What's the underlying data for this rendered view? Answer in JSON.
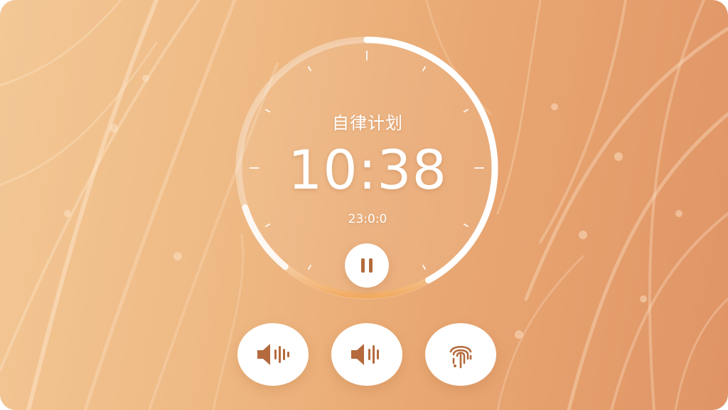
{
  "timer": {
    "label": "自律计划",
    "time": "10:38",
    "sub_time": "23:0:0",
    "progress_fraction": 0.42
  },
  "controls": {
    "pause_icon": "pause-icon",
    "buttons": [
      {
        "name": "sound-button-1",
        "icon": "speaker-wave-icon"
      },
      {
        "name": "sound-button-2",
        "icon": "speaker-wave-icon"
      },
      {
        "name": "fingerprint-button",
        "icon": "fingerprint-icon"
      }
    ]
  },
  "colors": {
    "background_light": "#f3c896",
    "background_dark": "#e09466",
    "ring_progress": "#ffffff",
    "ring_glow": "#f2a758",
    "icon": "#b46a3c"
  }
}
